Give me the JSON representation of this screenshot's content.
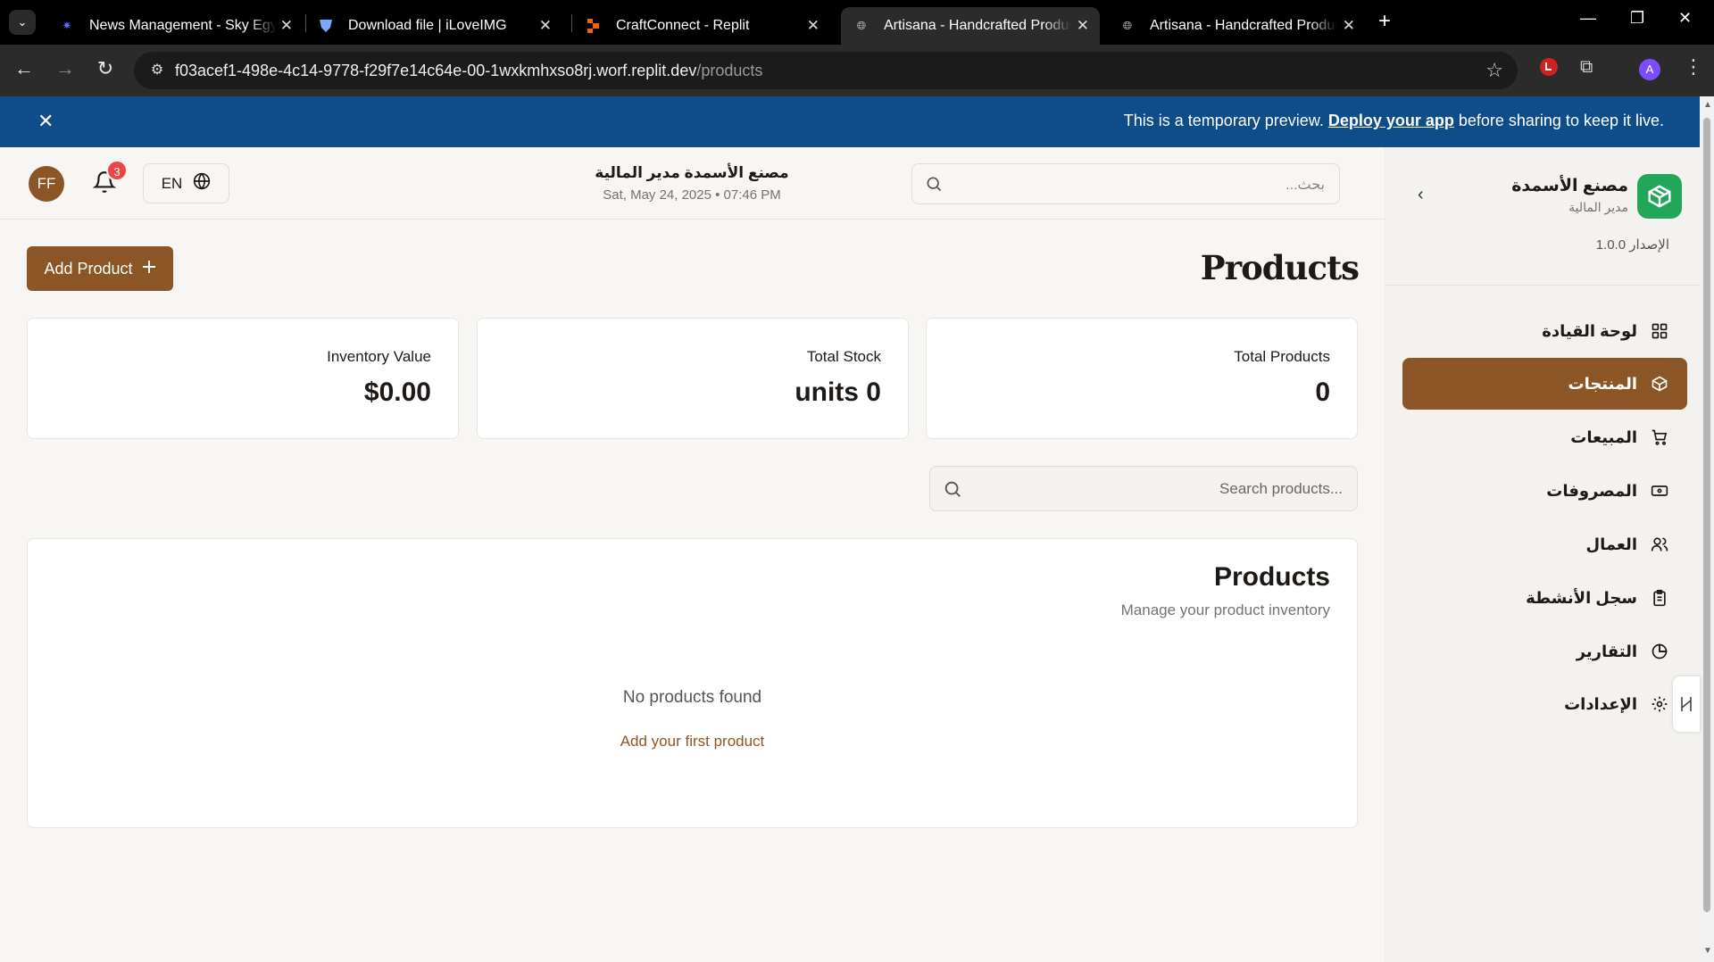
{
  "browser": {
    "tabs": [
      {
        "title": "News Management - Sky Egypt",
        "active": false
      },
      {
        "title": "Download file | iLoveIMG",
        "active": false
      },
      {
        "title": "CraftConnect - Replit",
        "active": false
      },
      {
        "title": "Artisana - Handcrafted Products",
        "active": true
      },
      {
        "title": "Artisana - Handcrafted Products",
        "active": false
      }
    ],
    "url_host": "f03acef1-498e-4c14-9778-f29f7e14c64e-00-1wxkmhxso8rj.worf.replit.dev",
    "url_path": "/products",
    "profile_initial": "A"
  },
  "banner": {
    "text_before": "This is a temporary preview. ",
    "link": "Deploy your app",
    "text_after": " before sharing to keep it live."
  },
  "header": {
    "avatar_initials": "FF",
    "notification_count": "3",
    "language": "EN",
    "title": "مصنع الأسمدة مدير المالية",
    "datetime": "Sat, May 24, 2025 • 07:46 PM",
    "search_placeholder": "بحث..."
  },
  "sidebar": {
    "brand_name": "مصنع الأسمدة",
    "brand_role": "مدير المالية",
    "version": "الإصدار 1.0.0",
    "items": [
      {
        "label": "لوحة القيادة",
        "icon": "dashboard-grid-icon",
        "active": false
      },
      {
        "label": "المنتجات",
        "icon": "package-icon",
        "active": true
      },
      {
        "label": "المبيعات",
        "icon": "cart-icon",
        "active": false
      },
      {
        "label": "المصروفات",
        "icon": "banknote-icon",
        "active": false
      },
      {
        "label": "العمال",
        "icon": "users-icon",
        "active": false
      },
      {
        "label": "سجل الأنشطة",
        "icon": "clipboard-icon",
        "active": false
      },
      {
        "label": "التقارير",
        "icon": "pie-chart-icon",
        "active": false
      },
      {
        "label": "الإعدادات",
        "icon": "gear-icon",
        "active": false
      }
    ]
  },
  "main": {
    "add_button": "Add Product",
    "page_title": "Products",
    "stats": [
      {
        "label": "Inventory Value",
        "value": "$0.00"
      },
      {
        "label": "Total Stock",
        "value": "units 0"
      },
      {
        "label": "Total Products",
        "value": "0"
      }
    ],
    "search_placeholder": "Search products...",
    "table": {
      "title": "Products",
      "subtitle": "Manage your product inventory",
      "empty_message": "No products found",
      "empty_action": "Add your first product"
    }
  },
  "colors": {
    "accent": "#8b5526",
    "banner": "#0f4c8a",
    "brand_logo": "#22a75a",
    "badge": "#ef4444"
  }
}
